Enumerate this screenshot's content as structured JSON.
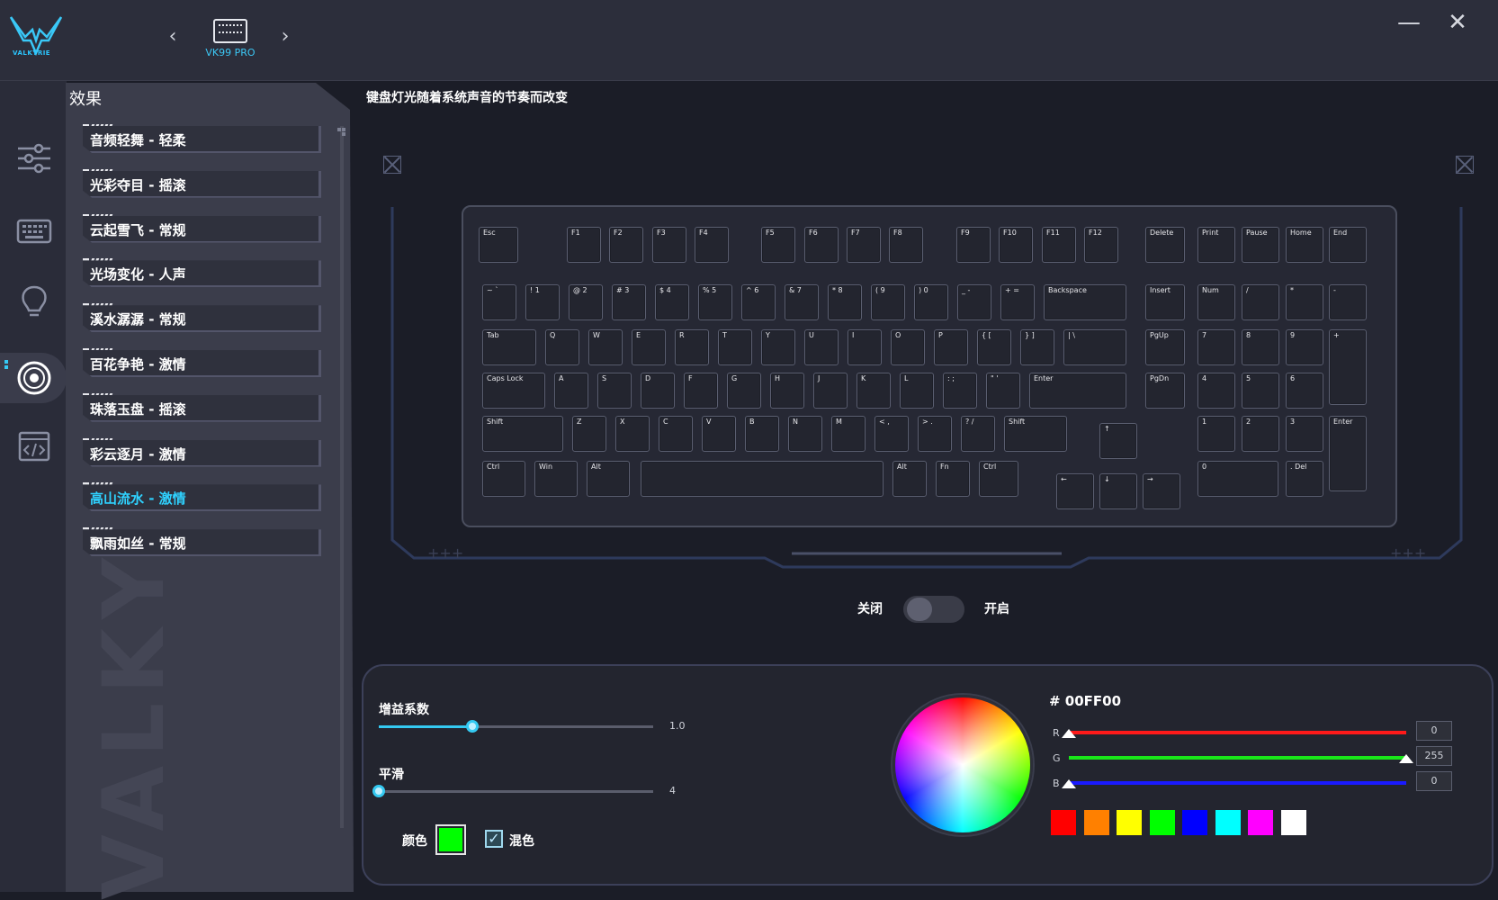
{
  "app": {
    "brand": "VALKYRIE"
  },
  "device": {
    "name": "VK99 PRO"
  },
  "window": {
    "minimize": "—",
    "close": "✕"
  },
  "rail": {
    "items": [
      {
        "name": "sliders-icon"
      },
      {
        "name": "keyboard-icon"
      },
      {
        "name": "lightbulb-icon"
      },
      {
        "name": "disc-icon"
      },
      {
        "name": "code-icon"
      }
    ]
  },
  "effects": {
    "title": "效果",
    "items": [
      {
        "label": "音频轻舞 - 轻柔"
      },
      {
        "label": "光彩夺目 - 摇滚"
      },
      {
        "label": "云起雪飞 - 常规"
      },
      {
        "label": "光场变化 - 人声"
      },
      {
        "label": "溪水潺潺 - 常规"
      },
      {
        "label": "百花争艳 - 激情"
      },
      {
        "label": "珠落玉盘 - 摇滚"
      },
      {
        "label": "彩云逐月 - 激情"
      },
      {
        "label": "高山流水 - 激情",
        "active": true
      },
      {
        "label": "飘雨如丝 - 常规"
      }
    ],
    "watermark": "VALKY"
  },
  "description": "键盘灯光随着系统声音的节奏而改变",
  "keyboard": {
    "rows": [
      [
        "Esc",
        "F1",
        "F2",
        "F3",
        "F4",
        "F5",
        "F6",
        "F7",
        "F8",
        "F9",
        "F10",
        "F11",
        "F12",
        "Delete",
        "Print",
        "Pause",
        "Home",
        "End"
      ],
      [
        "~ `",
        "! 1",
        "@ 2",
        "# 3",
        "$ 4",
        "% 5",
        "^ 6",
        "& 7",
        "* 8",
        "( 9",
        ") 0",
        "_ -",
        "+ =",
        "Backspace",
        "Insert",
        "Num",
        "/",
        "*",
        "-"
      ],
      [
        "Tab",
        "Q",
        "W",
        "E",
        "R",
        "T",
        "Y",
        "U",
        "I",
        "O",
        "P",
        "{ [",
        "} ]",
        "| \\",
        "PgUp",
        "7",
        "8",
        "9",
        "+"
      ],
      [
        "Caps Lock",
        "A",
        "S",
        "D",
        "F",
        "G",
        "H",
        "J",
        "K",
        "L",
        ": ;",
        "\" '",
        "Enter",
        "PgDn",
        "4",
        "5",
        "6"
      ],
      [
        "Shift",
        "Z",
        "X",
        "C",
        "V",
        "B",
        "N",
        "M",
        "< ,",
        "> .",
        "? /",
        "Shift",
        "↑",
        "1",
        "2",
        "3",
        "Enter"
      ],
      [
        "Ctrl",
        "Win",
        "Alt",
        "",
        "Alt",
        "Fn",
        "Ctrl",
        "←",
        "↓",
        "→",
        "0",
        ". Del"
      ]
    ]
  },
  "toggle": {
    "off": "关闭",
    "on": "开启",
    "state": false
  },
  "controls": {
    "gain": {
      "label": "增益系数",
      "value": "1.0",
      "fraction": 0.34
    },
    "smooth": {
      "label": "平滑",
      "value": "4",
      "fraction": 0.0
    },
    "color_label": "颜色",
    "mix_label": "混色",
    "mix_checked": true,
    "color": "#00FF00"
  },
  "picker": {
    "hex": "# 00FF00",
    "r": {
      "letter": "R",
      "value": "0",
      "fraction": 0.0,
      "color": "#ff1a1a"
    },
    "g": {
      "letter": "G",
      "value": "255",
      "fraction": 1.0,
      "color": "#19e619"
    },
    "b": {
      "letter": "B",
      "value": "0",
      "fraction": 0.0,
      "color": "#1a1aff"
    },
    "presets": [
      "#ff0000",
      "#ff8000",
      "#ffff00",
      "#00ff00",
      "#0000ff",
      "#00ffff",
      "#ff00ff",
      "#ffffff"
    ]
  }
}
